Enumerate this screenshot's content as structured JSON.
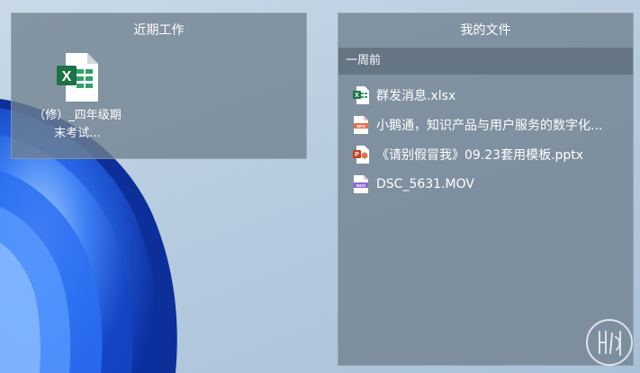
{
  "recent_panel": {
    "title": "近期工作",
    "files": [
      {
        "label": "（修）_四年级期末考试...",
        "icon": "excel-icon"
      }
    ]
  },
  "files_panel": {
    "title": "我的文件",
    "group_label": "一周前",
    "files": [
      {
        "name": "群发消息.xlsx",
        "icon": "excel-icon"
      },
      {
        "name": "小鹅通，知识产品与用户服务的数字化...",
        "icon": "mp4-icon"
      },
      {
        "name": "《请别假冒我》09.23套用模板.pptx",
        "icon": "powerpoint-icon"
      },
      {
        "name": "DSC_5631.MOV",
        "icon": "mov-icon"
      }
    ]
  },
  "colors": {
    "excel_green": "#1e7145",
    "mp4_orange": "#e2734f",
    "ppt_red": "#c43e1c",
    "mov_purple": "#8a6bc9",
    "panel_bg": "#70808e",
    "bloom_blue": "#1f5fe0"
  }
}
